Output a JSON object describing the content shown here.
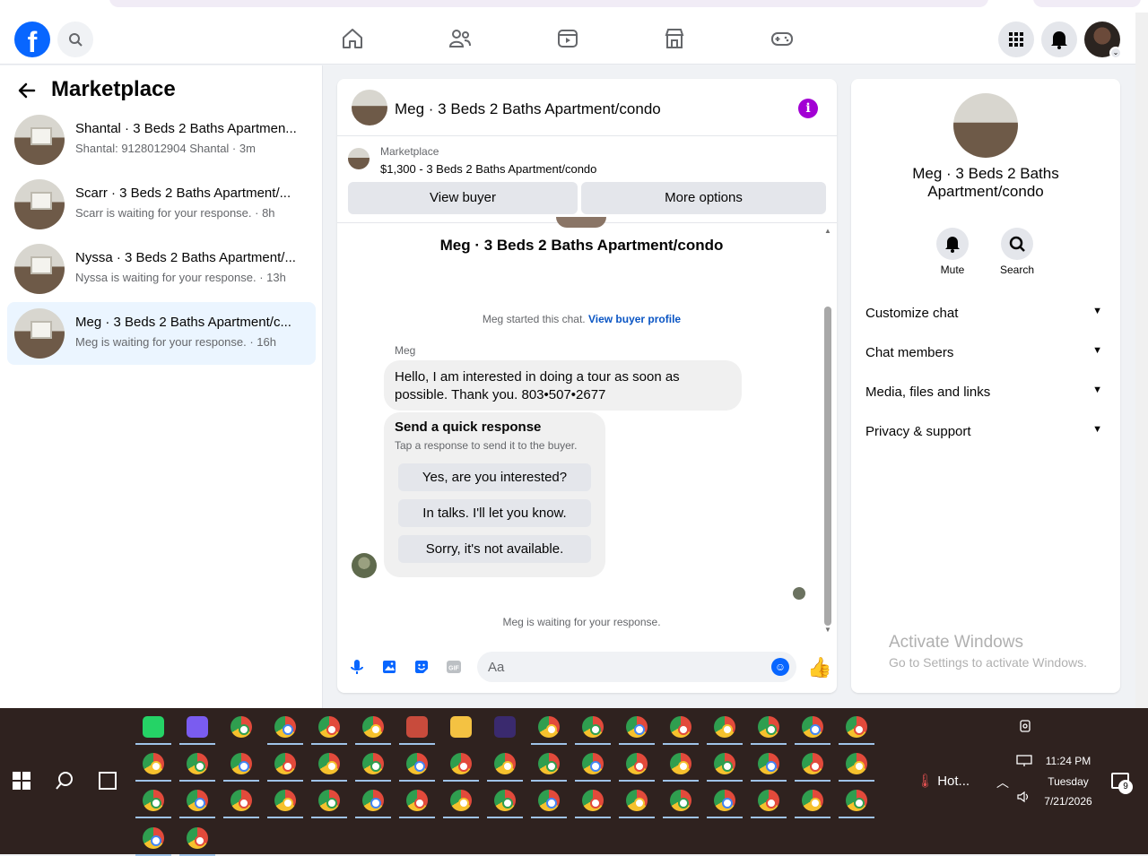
{
  "header": {
    "logo": "f",
    "nav": [
      "home-icon",
      "friends-icon",
      "video-icon",
      "marketplace-icon",
      "gaming-icon"
    ]
  },
  "left": {
    "title": "Marketplace",
    "conversations": [
      {
        "title": "Shantal · 3 Beds 2 Baths Apartmen...",
        "sub": "Shantal: 9128012904 Shantal · 3m"
      },
      {
        "title": "Scarr · 3 Beds 2 Baths Apartment/...",
        "sub": "Scarr is waiting for your response. · 8h"
      },
      {
        "title": "Nyssa · 3 Beds 2 Baths Apartment/...",
        "sub": "Nyssa is waiting for your response. · 13h"
      },
      {
        "title": "Meg · 3 Beds 2 Baths Apartment/c...",
        "sub": "Meg is waiting for your response. · 16h"
      }
    ]
  },
  "chat": {
    "title": "Meg · 3 Beds 2 Baths Apartment/condo",
    "info_glyph": "i",
    "listing_label": "Marketplace",
    "listing_price": "$1,300 - 3 Beds 2 Baths Apartment/condo",
    "view_buyer": "View buyer",
    "more_options": "More options",
    "thread_title": "Meg · 3 Beds 2 Baths Apartment/condo",
    "started_text": "Meg started this chat. ",
    "started_link": "View buyer profile",
    "sender": "Meg",
    "message": "Hello, I am interested in doing a tour as soon as possible. Thank you. 803•507•2677",
    "quick_title": "Send a quick response",
    "quick_sub": "Tap a response to send it to the buyer.",
    "quick_replies": [
      "Yes, are you interested?",
      "In talks. I'll let you know.",
      "Sorry, it's not available."
    ],
    "waiting": "Meg is waiting for your response.",
    "input_placeholder": "Aa"
  },
  "right": {
    "name": "Meg · 3 Beds 2 Baths Apartment/condo",
    "mute": "Mute",
    "search": "Search",
    "sections": [
      "Customize chat",
      "Chat members",
      "Media, files and links",
      "Privacy & support"
    ]
  },
  "watermark": {
    "line1": "Activate Windows",
    "line2": "Go to Settings to activate Windows."
  },
  "taskbar": {
    "weather": "Hot...",
    "time": "11:24 PM",
    "day": "Tuesday",
    "date": "7/21/2026",
    "notification_count": "9"
  },
  "colors": {
    "accent": "#0866ff",
    "info_purple": "#a200d4",
    "taskbar": "#2f221f"
  }
}
